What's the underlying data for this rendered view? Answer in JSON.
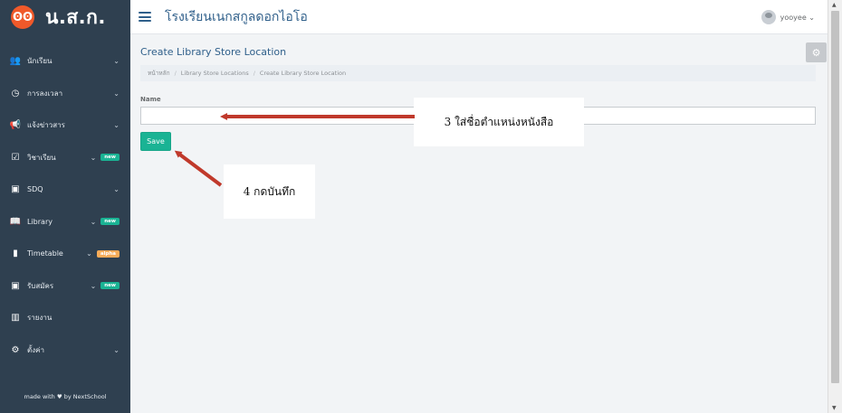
{
  "sidebar": {
    "brand": {
      "logo_text": "ʘʘ",
      "name": "น.ส.ก."
    },
    "items": [
      {
        "icon": "users-icon",
        "glyph": "👥",
        "label": "นักเรียน",
        "chevron": "⌄",
        "badge": ""
      },
      {
        "icon": "clock-icon",
        "glyph": "◷",
        "label": "การลงเวลา",
        "chevron": "⌄",
        "badge": ""
      },
      {
        "icon": "megaphone-icon",
        "glyph": "📢",
        "label": "แจ้งข่าวสาร",
        "chevron": "⌄",
        "badge": ""
      },
      {
        "icon": "calendar-check-icon",
        "glyph": "☑",
        "label": "วิชาเรียน",
        "chevron": "⌄",
        "badge": "new"
      },
      {
        "icon": "clipboard-icon",
        "glyph": "▣",
        "label": "SDQ",
        "chevron": "⌄",
        "badge": ""
      },
      {
        "icon": "book-icon",
        "glyph": "📖",
        "label": "Library",
        "chevron": "⌄",
        "badge": "new"
      },
      {
        "icon": "file-icon",
        "glyph": "▮",
        "label": "Timetable",
        "chevron": "⌄",
        "badge": "alpha"
      },
      {
        "icon": "id-card-icon",
        "glyph": "▣",
        "label": "รับสมัคร",
        "chevron": "⌄",
        "badge": "new"
      },
      {
        "icon": "bar-chart-icon",
        "glyph": "▥",
        "label": "รายงาน",
        "chevron": "",
        "badge": ""
      },
      {
        "icon": "cogs-icon",
        "glyph": "⚙",
        "label": "ตั้งค่า",
        "chevron": "⌄",
        "badge": ""
      }
    ],
    "footer": "made with ♥ by NextSchool"
  },
  "topbar": {
    "school_name": "โรงเรียนเนกสกูลดอกไอโอ",
    "user_name": "yooyee ⌄"
  },
  "page": {
    "title": "Create Library Store Location",
    "breadcrumb": [
      "หน้าหลัก",
      "Library Store Locations",
      "Create Library Store Location"
    ],
    "form": {
      "name_label": "Name",
      "name_value": "",
      "save_label": "Save"
    }
  },
  "annotations": {
    "step3": "3 ใส่ชื่อตำแหน่งหนังสือ",
    "step4": "4 กดบันทึก",
    "arrow_color": "#c0392b"
  },
  "colors": {
    "sidebar": "#2f4050",
    "accent": "#1ab394",
    "brand_logo": "#f0592a",
    "title": "#2f5f8a"
  }
}
